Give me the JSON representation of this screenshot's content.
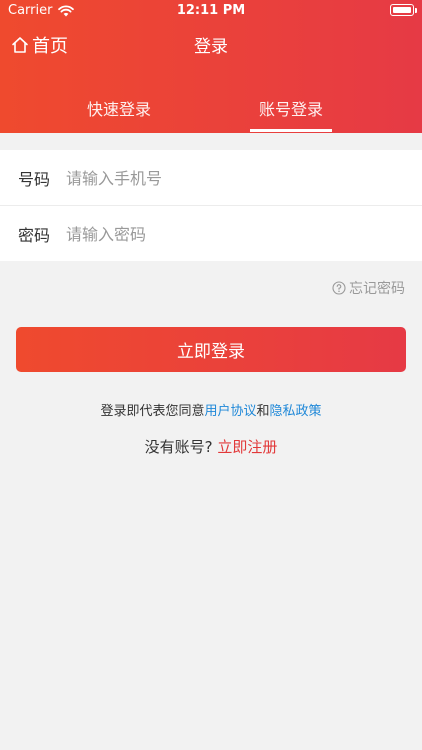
{
  "status_bar": {
    "carrier": "Carrier",
    "time": "12:11 PM",
    "battery_level": 1.0
  },
  "nav": {
    "home_label": "首页",
    "title": "登录"
  },
  "tabs": [
    {
      "label": "快速登录",
      "active": false
    },
    {
      "label": "账号登录",
      "active": true
    }
  ],
  "form": {
    "phone_label": "号码",
    "phone_placeholder": "请输入手机号",
    "phone_value": "",
    "password_label": "密码",
    "password_placeholder": "请输入密码",
    "password_value": ""
  },
  "forgot_password": "忘记密码",
  "login_button": "立即登录",
  "agreement": {
    "prefix": "登录即代表您同意",
    "user_agreement": "用户协议",
    "conjunction": "和",
    "privacy_policy": "隐私政策"
  },
  "register": {
    "prompt": "没有账号?",
    "link": "立即注册"
  },
  "colors": {
    "brand_start": "#ef4a2e",
    "brand_end": "#e63a45",
    "link_blue": "#1f88d8",
    "link_red": "#e2393a"
  },
  "icons": {
    "wifi": "wifi-icon",
    "battery": "battery-icon",
    "home": "home-icon",
    "help": "question-circle-icon"
  }
}
